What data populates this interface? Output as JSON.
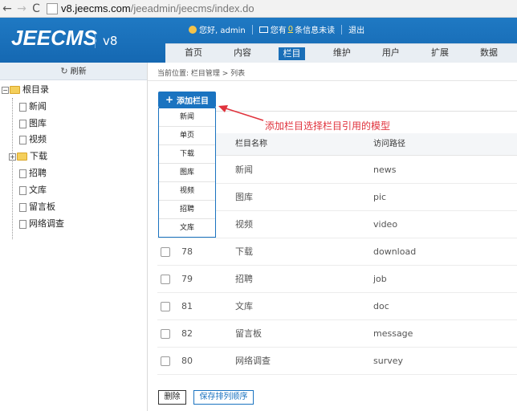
{
  "browser": {
    "back": "←",
    "forward": "→",
    "reload": "C",
    "url_host": "v8.jeecms.com",
    "url_path": "/jeeadmin/jeecms/index.do"
  },
  "header": {
    "logo": "JEECMS",
    "version": "v8",
    "greeting": "您好, admin",
    "msg_prefix": "您有",
    "msg_count": "0",
    "msg_suffix": "条信息未读",
    "logout": "退出"
  },
  "menu": [
    "首页",
    "内容",
    "栏目",
    "维护",
    "用户",
    "扩展",
    "数据"
  ],
  "sidebar": {
    "refresh": "刷新",
    "root": "根目录",
    "items": [
      {
        "label": "新闻",
        "type": "doc"
      },
      {
        "label": "图库",
        "type": "doc"
      },
      {
        "label": "视频",
        "type": "doc"
      },
      {
        "label": "下载",
        "type": "folder"
      },
      {
        "label": "招聘",
        "type": "doc"
      },
      {
        "label": "文库",
        "type": "doc"
      },
      {
        "label": "留言板",
        "type": "doc"
      },
      {
        "label": "网络调查",
        "type": "doc"
      }
    ]
  },
  "breadcrumb": "当前位置: 栏目管理 > 列表",
  "add_button": {
    "icon": "+",
    "label": "添加栏目"
  },
  "dropdown": [
    "新闻",
    "单页",
    "下载",
    "图库",
    "视频",
    "招聘",
    "文库"
  ],
  "annotation": "添加栏目选择栏目引用的模型",
  "table": {
    "columns": [
      "栏目名称",
      "访问路径"
    ],
    "rows": [
      {
        "id": "",
        "name": "新闻",
        "path": "news"
      },
      {
        "id": "",
        "name": "图库",
        "path": "pic"
      },
      {
        "id": "",
        "name": "视频",
        "path": "video"
      },
      {
        "id": "78",
        "name": "下载",
        "path": "download"
      },
      {
        "id": "79",
        "name": "招聘",
        "path": "job"
      },
      {
        "id": "81",
        "name": "文库",
        "path": "doc"
      },
      {
        "id": "82",
        "name": "留言板",
        "path": "message"
      },
      {
        "id": "80",
        "name": "网络调查",
        "path": "survey"
      }
    ]
  },
  "buttons": {
    "delete": "删除",
    "save_order": "保存排列顺序"
  },
  "colors": {
    "header_blue": "#1a6fb8",
    "annotation_red": "#e0323c"
  }
}
